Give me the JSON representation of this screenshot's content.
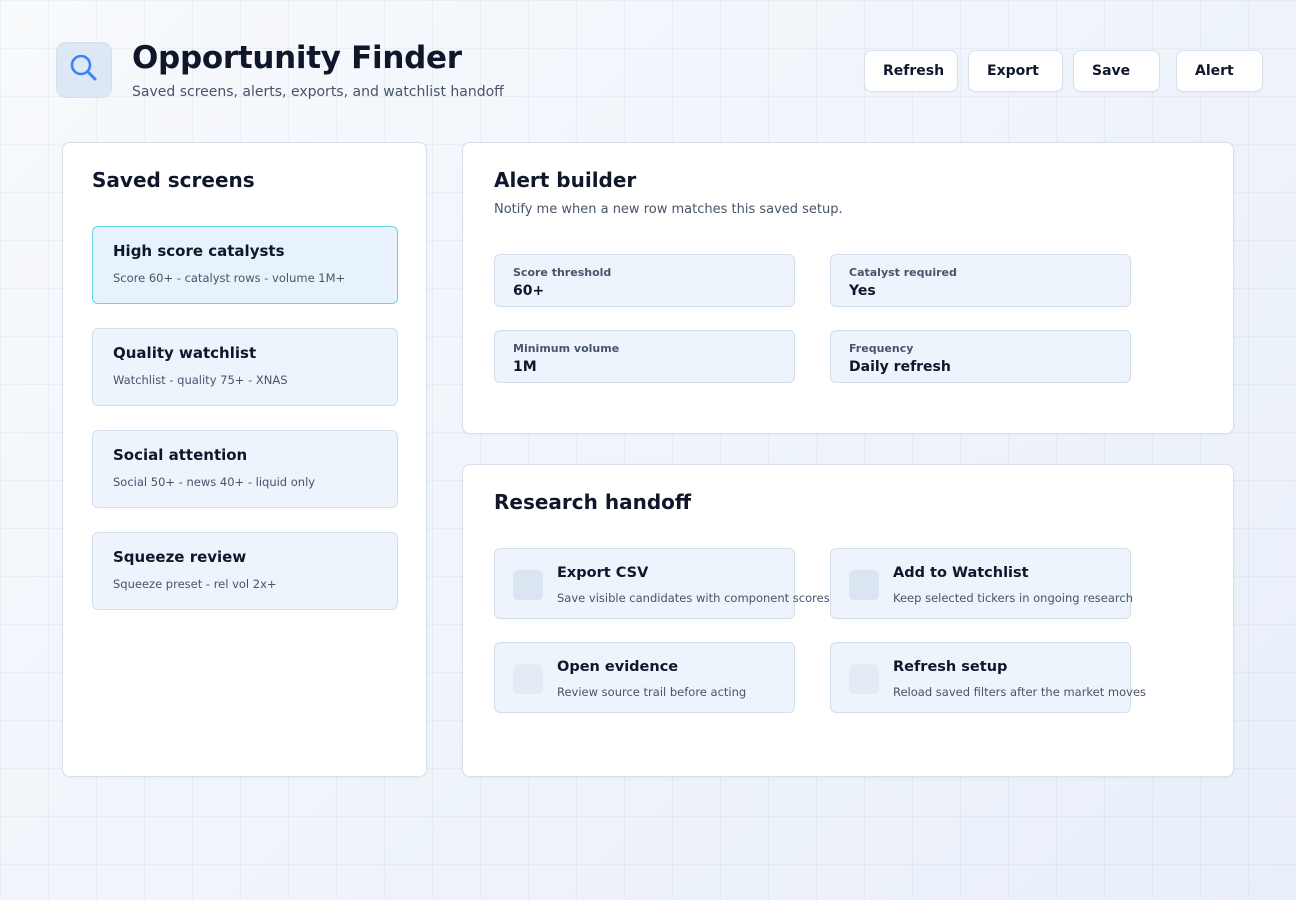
{
  "header": {
    "icon": "search-icon",
    "title": "Opportunity Finder",
    "subtitle": "Saved screens, alerts, exports, and watchlist handoff"
  },
  "toolbar": {
    "refresh_label": "Refresh",
    "export_label": "Export",
    "save_label": "Save",
    "alert_label": "Alert"
  },
  "saved_screens": {
    "title": "Saved screens",
    "items": [
      {
        "name": "High score catalysts",
        "description": "Score 60+ - catalyst rows - volume 1M+",
        "active": true
      },
      {
        "name": "Quality watchlist",
        "description": "Watchlist - quality 75+ - XNAS",
        "active": false
      },
      {
        "name": "Social attention",
        "description": "Social 50+ - news 40+ - liquid only",
        "active": false
      },
      {
        "name": "Squeeze review",
        "description": "Squeeze preset - rel vol 2x+",
        "active": false
      }
    ]
  },
  "alert_builder": {
    "title": "Alert builder",
    "subtitle": "Notify me when a new row matches this saved setup.",
    "fields": [
      {
        "label": "Score threshold",
        "value": "60+"
      },
      {
        "label": "Catalyst required",
        "value": "Yes"
      },
      {
        "label": "Minimum volume",
        "value": "1M"
      },
      {
        "label": "Frequency",
        "value": "Daily refresh"
      }
    ]
  },
  "research_handoff": {
    "title": "Research handoff",
    "actions": [
      {
        "title": "Export CSV",
        "description": "Save visible candidates with component scores"
      },
      {
        "title": "Add to Watchlist",
        "description": "Keep selected tickers in ongoing research"
      },
      {
        "title": "Open evidence",
        "description": "Review source trail before acting"
      },
      {
        "title": "Refresh setup",
        "description": "Reload saved filters after the market moves"
      }
    ]
  },
  "colors": {
    "accent": "#3b82f6",
    "active_border": "#67d4ea",
    "card_background": "#eef4fc",
    "text_primary": "#0f172a",
    "text_secondary": "#475569"
  }
}
